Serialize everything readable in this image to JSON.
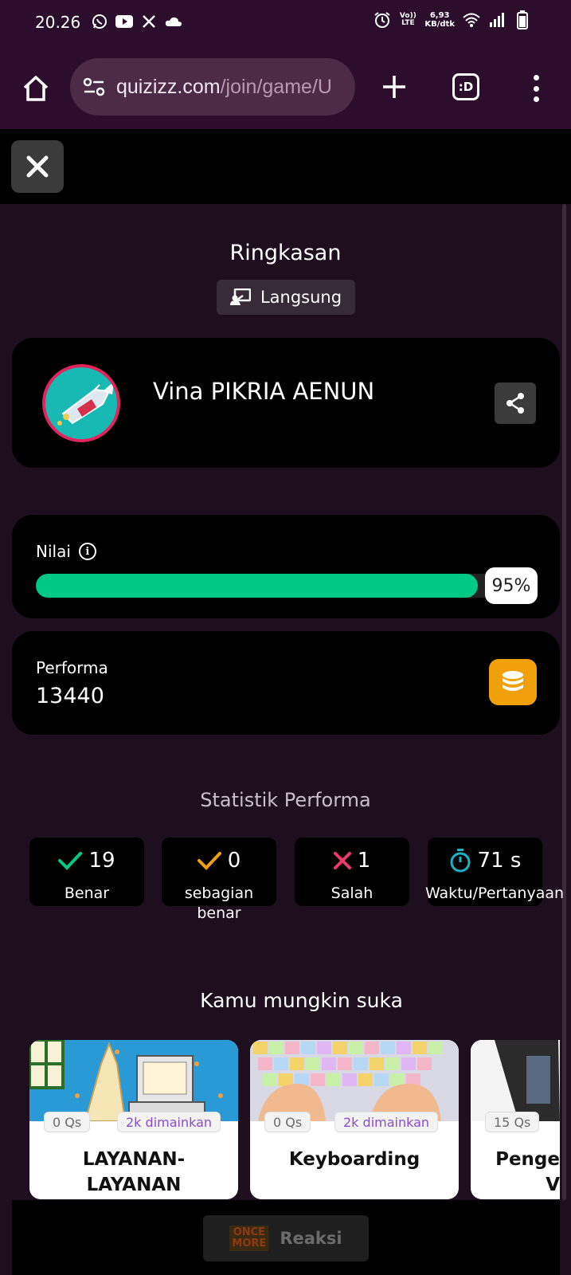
{
  "status_bar": {
    "time": "20.26",
    "volte_label": "Vo)) LTE",
    "net_speed_value": "6,93",
    "net_speed_unit": "KB/dtk",
    "icons": [
      "whatsapp-icon",
      "youtube-icon",
      "x-icon",
      "cloud-icon",
      "alarm-icon",
      "wifi-icon",
      "signal-icon",
      "battery-icon"
    ]
  },
  "browser": {
    "url_host": "quizizz.com",
    "url_path": "/join/game/U",
    "tabs_label": ":D"
  },
  "summary": {
    "title": "Ringkasan",
    "mode_label": "Langsung"
  },
  "player": {
    "name": "Vina PIKRIA AENUN"
  },
  "score": {
    "label": "Nilai",
    "percent": 95,
    "percent_text": "95%"
  },
  "performance": {
    "label": "Performa",
    "value": "13440"
  },
  "stats": {
    "title": "Statistik Performa",
    "items": [
      {
        "value": "19",
        "label": "Benar",
        "icon": "check-icon",
        "color": "#00c985"
      },
      {
        "value": "0",
        "label": "sebagian\nbenar",
        "icon": "partial-check-icon",
        "color": "#f0a00a"
      },
      {
        "value": "1",
        "label": "Salah",
        "icon": "cross-icon",
        "color": "#ec3b6b"
      },
      {
        "value": "71 s",
        "label": "Waktu/Pertanyaan",
        "icon": "stopwatch-icon",
        "color": "#1ab3c6"
      }
    ]
  },
  "suggestions": {
    "title": "Kamu mungkin suka",
    "cards": [
      {
        "qs": "0 Qs",
        "played": "2k dimainkan",
        "title": "LAYANAN-\nLAYANAN"
      },
      {
        "qs": "0 Qs",
        "played": "2k dimainkan",
        "title": "Keyboarding"
      },
      {
        "qs": "15 Qs",
        "played": "",
        "title": "Penge\nV"
      }
    ]
  },
  "bottom": {
    "logo_text": "ONCE\nMORE",
    "react_label": "Reaksi"
  },
  "colors": {
    "accent_green": "#00c985",
    "coin_orange": "#f0a00a",
    "browser_bar": "#2c0e2c",
    "background": "#1d0f1d"
  }
}
